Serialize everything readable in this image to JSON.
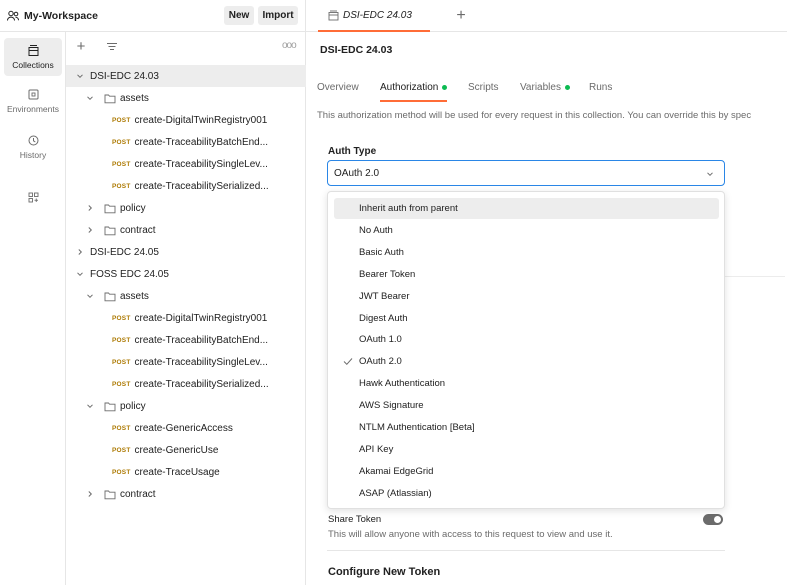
{
  "workspace": {
    "name": "My-Workspace",
    "new_label": "New",
    "import_label": "Import"
  },
  "tab": {
    "label": "DSI-EDC 24.03",
    "plus": "+"
  },
  "rail": [
    {
      "label": "Collections",
      "icon": "collections-icon",
      "active": true
    },
    {
      "label": "Environments",
      "icon": "environments-icon"
    },
    {
      "label": "History",
      "icon": "history-icon"
    },
    {
      "label": "",
      "icon": "add-apps-icon"
    }
  ],
  "sidebar": {
    "plus": "+",
    "dots": "ooo",
    "tree": [
      {
        "type": "collection",
        "label": "DSI-EDC 24.03",
        "expanded": true,
        "depth": 0,
        "selected": true
      },
      {
        "type": "folder",
        "label": "assets",
        "expanded": true,
        "depth": 1
      },
      {
        "type": "request",
        "method": "POST",
        "label": "create-DigitalTwinRegistry001",
        "depth": 2
      },
      {
        "type": "request",
        "method": "POST",
        "label": "create-TraceabilityBatchEnd...",
        "depth": 2
      },
      {
        "type": "request",
        "method": "POST",
        "label": "create-TraceabilitySingleLev...",
        "depth": 2
      },
      {
        "type": "request",
        "method": "POST",
        "label": "create-TraceabilitySerialized...",
        "depth": 2
      },
      {
        "type": "folder",
        "label": "policy",
        "expanded": false,
        "depth": 1
      },
      {
        "type": "folder",
        "label": "contract",
        "expanded": false,
        "depth": 1
      },
      {
        "type": "collection",
        "label": "DSI-EDC 24.05",
        "expanded": false,
        "depth": 0
      },
      {
        "type": "collection",
        "label": "FOSS EDC 24.05",
        "expanded": true,
        "depth": 0
      },
      {
        "type": "folder",
        "label": "assets",
        "expanded": true,
        "depth": 1
      },
      {
        "type": "request",
        "method": "POST",
        "label": "create-DigitalTwinRegistry001",
        "depth": 2
      },
      {
        "type": "request",
        "method": "POST",
        "label": "create-TraceabilityBatchEnd...",
        "depth": 2
      },
      {
        "type": "request",
        "method": "POST",
        "label": "create-TraceabilitySingleLev...",
        "depth": 2
      },
      {
        "type": "request",
        "method": "POST",
        "label": "create-TraceabilitySerialized...",
        "depth": 2
      },
      {
        "type": "folder",
        "label": "policy",
        "expanded": true,
        "depth": 1
      },
      {
        "type": "request",
        "method": "POST",
        "label": "create-GenericAccess",
        "depth": 2
      },
      {
        "type": "request",
        "method": "POST",
        "label": "create-GenericUse",
        "depth": 2
      },
      {
        "type": "request",
        "method": "POST",
        "label": "create-TraceUsage",
        "depth": 2
      },
      {
        "type": "folder",
        "label": "contract",
        "expanded": false,
        "depth": 1
      }
    ]
  },
  "main": {
    "title": "DSI-EDC 24.03",
    "subtabs": [
      {
        "label": "Overview"
      },
      {
        "label": "Authorization",
        "dot": true,
        "active": true
      },
      {
        "label": "Scripts"
      },
      {
        "label": "Variables",
        "dot": true
      },
      {
        "label": "Runs"
      }
    ],
    "description": "This authorization method will be used for every request in this collection. You can override this by spec",
    "auth_type_label": "Auth Type",
    "auth_type_value": "OAuth 2.0",
    "dropdown": [
      {
        "label": "Inherit auth from parent",
        "hover": true
      },
      {
        "label": "No Auth"
      },
      {
        "label": "Basic Auth"
      },
      {
        "label": "Bearer Token"
      },
      {
        "label": "JWT Bearer"
      },
      {
        "label": "Digest Auth"
      },
      {
        "label": "OAuth 1.0"
      },
      {
        "label": "OAuth 2.0",
        "checked": true
      },
      {
        "label": "Hawk Authentication"
      },
      {
        "label": "AWS Signature"
      },
      {
        "label": "NTLM Authentication [Beta]"
      },
      {
        "label": "API Key"
      },
      {
        "label": "Akamai EdgeGrid"
      },
      {
        "label": "ASAP (Atlassian)"
      }
    ],
    "share_token_label": "Share Token",
    "share_token_desc": "This will allow anyone with access to this request to view and use it.",
    "configure_title": "Configure New Token"
  },
  "colors": {
    "accent": "#ff6c37",
    "post": "#ad7a03",
    "green_dot": "#0cbb52",
    "focus": "#2a86e6"
  }
}
